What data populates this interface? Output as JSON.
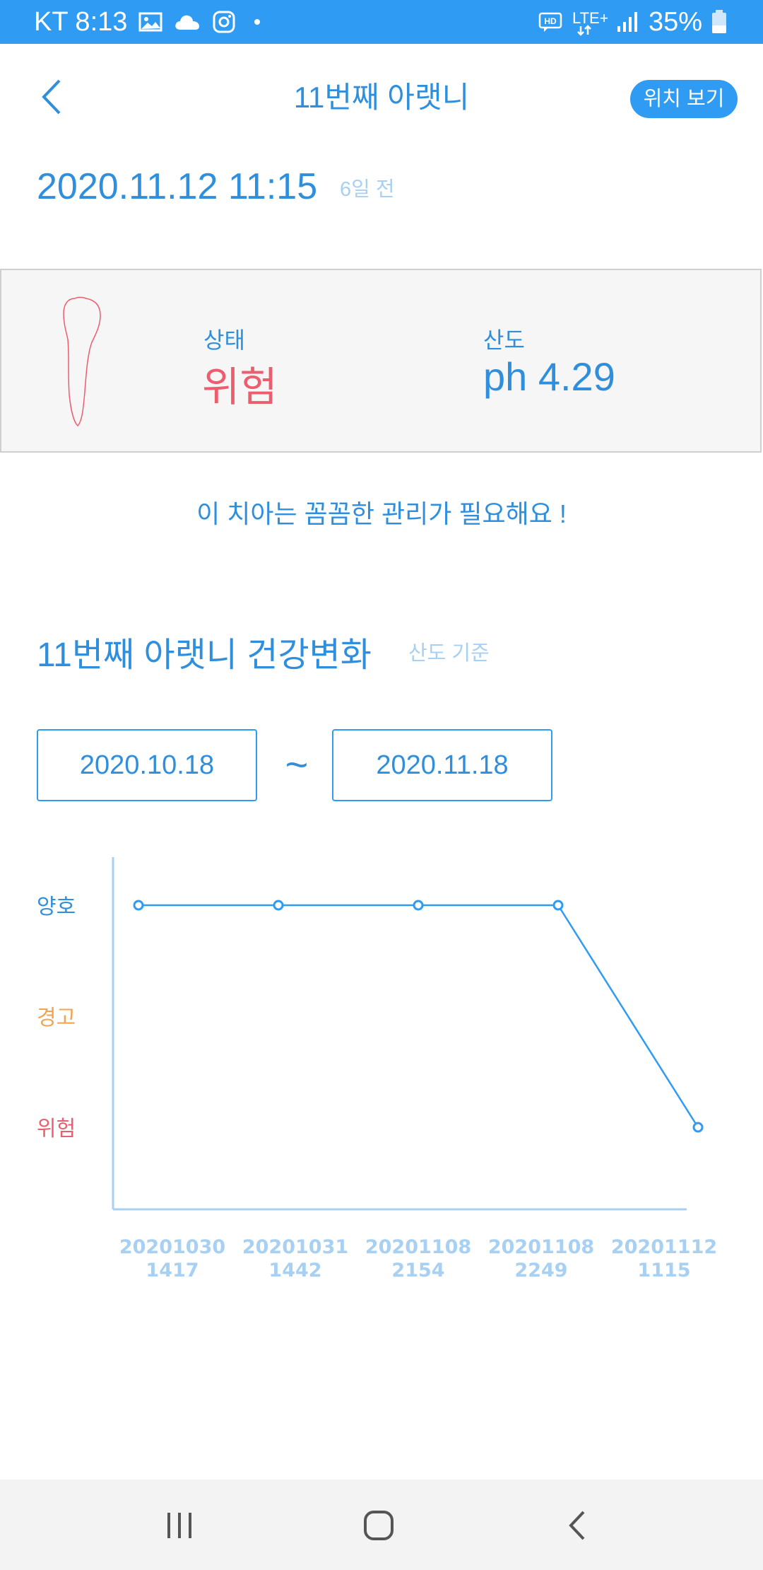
{
  "status_bar": {
    "carrier_time": "KT 8:13",
    "network": "LTE+",
    "battery": "35%",
    "icons_left": [
      "gallery-icon",
      "cloud-icon",
      "instagram-icon",
      "dot-icon"
    ],
    "icons_right": [
      "hd-voice-icon",
      "lte-icon",
      "signal-icon",
      "battery-icon"
    ]
  },
  "header": {
    "title": "11번째 아랫니",
    "location_button": "위치 보기",
    "back_icon": "chevron-left-icon"
  },
  "record": {
    "datetime": "2020.11.12 11:15",
    "ago": "6일 전"
  },
  "status_card": {
    "state_label": "상태",
    "state_value": "위험",
    "acidity_label": "산도",
    "acidity_value": "ph 4.29",
    "tooth_icon": "tooth-outline-icon",
    "colors": {
      "danger": "#ec5d6e",
      "primary": "#2f8fdc"
    }
  },
  "message": "이 치아는 꼼꼼한 관리가 필요해요 !",
  "health_section": {
    "title": "11번째 아랫니 건강변화",
    "subtitle": "산도 기준",
    "range_start": "2020.10.18",
    "range_separator": "~",
    "range_end": "2020.11.18"
  },
  "chart_data": {
    "type": "line",
    "levels": [
      {
        "label": "양호",
        "color": "#2f8fdc"
      },
      {
        "label": "경고",
        "color": "#f0a552"
      },
      {
        "label": "위험",
        "color": "#ec5d6e"
      }
    ],
    "x": [
      [
        "20201030",
        "1417"
      ],
      [
        "20201031",
        "1442"
      ],
      [
        "20201108",
        "2154"
      ],
      [
        "20201108",
        "2249"
      ],
      [
        "20201112",
        "1115"
      ]
    ],
    "values": [
      "양호",
      "양호",
      "양호",
      "양호",
      "위험"
    ],
    "line_color": "#2f9bf2",
    "tick_color": "#a8d0f2"
  },
  "nav_bar": {
    "recents_icon": "recents-icon",
    "home_icon": "home-icon",
    "back_icon": "back-icon"
  }
}
